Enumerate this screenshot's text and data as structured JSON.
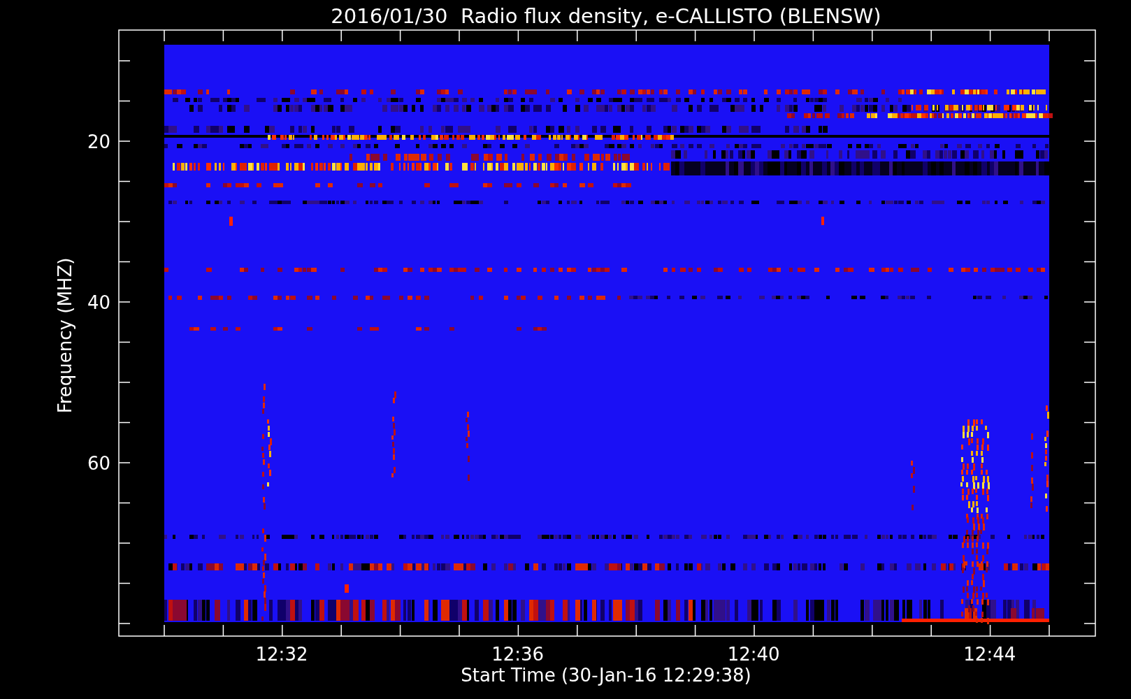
{
  "title": "2016/01/30  Radio flux density, e-CALLISTO (BLENSW)",
  "plot": {
    "kind": "spectrogram",
    "y_axis": {
      "label": "Frequency (MHZ)",
      "ticks": [
        "20",
        "40",
        "60"
      ]
    },
    "x_axis": {
      "label": "Start Time (30-Jan-16 12:29:38)",
      "ticks": [
        "12:32",
        "12:36",
        "12:40",
        "12:44"
      ]
    }
  }
}
